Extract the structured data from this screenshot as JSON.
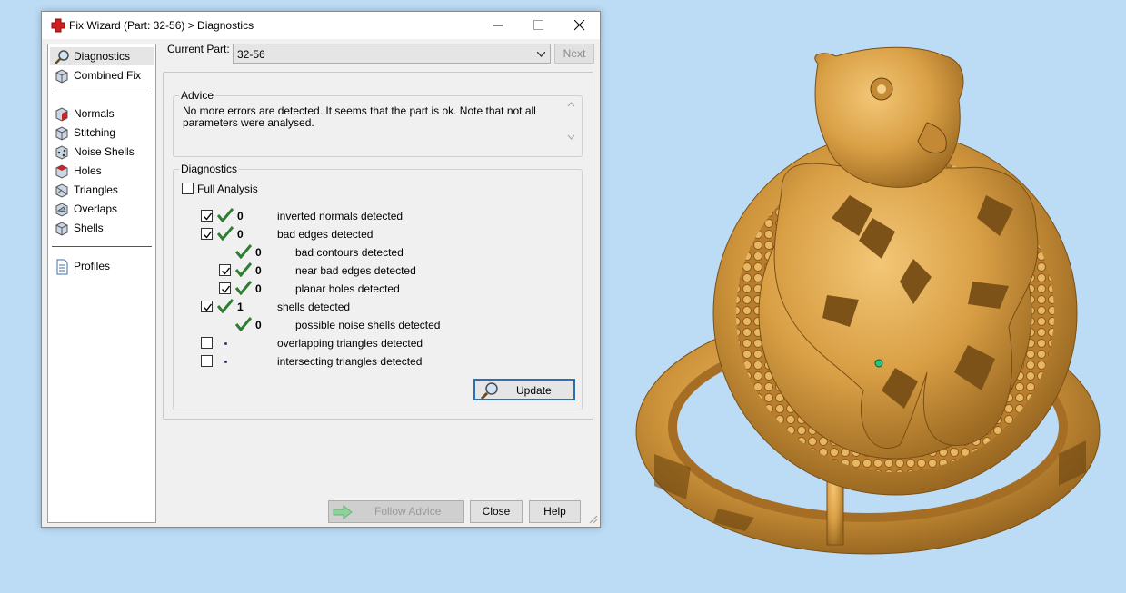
{
  "window": {
    "title": "Fix Wizard (Part: 32-56) > Diagnostics",
    "app_icon": "red-cross-icon"
  },
  "nav": {
    "items": [
      {
        "label": "Diagnostics",
        "icon": "magnifier-icon",
        "selected": true
      },
      {
        "label": "Combined Fix",
        "icon": "cube-icon"
      },
      {
        "label": "Normals",
        "icon": "normals-cube-icon"
      },
      {
        "label": "Stitching",
        "icon": "stitching-cube-icon"
      },
      {
        "label": "Noise Shells",
        "icon": "noise-shells-cube-icon"
      },
      {
        "label": "Holes",
        "icon": "holes-cube-icon"
      },
      {
        "label": "Triangles",
        "icon": "triangles-cube-icon"
      },
      {
        "label": "Overlaps",
        "icon": "overlaps-cube-icon"
      },
      {
        "label": "Shells",
        "icon": "shells-cube-icon"
      },
      {
        "label": "Profiles",
        "icon": "document-icon"
      }
    ]
  },
  "part": {
    "label": "Current Part:",
    "value": "32-56",
    "next_label": "Next"
  },
  "advice": {
    "title": "Advice",
    "text_line1": "No more errors are detected. It seems that the part is ok. Note that not all",
    "text_line2": "parameters were analysed."
  },
  "diagnostics": {
    "title": "Diagnostics",
    "full_analysis_label": "Full Analysis",
    "full_analysis_checked": false,
    "rows": [
      {
        "checked": true,
        "status": "ok",
        "count": "0",
        "label": "inverted normals detected",
        "indent": 0,
        "has_checkbox": true
      },
      {
        "checked": true,
        "status": "ok",
        "count": "0",
        "label": "bad edges detected",
        "indent": 0,
        "has_checkbox": true
      },
      {
        "checked": null,
        "status": "ok",
        "count": "0",
        "label": "bad contours detected",
        "indent": 1,
        "has_checkbox": false
      },
      {
        "checked": true,
        "status": "ok",
        "count": "0",
        "label": "near bad edges detected",
        "indent": 1,
        "has_checkbox": true
      },
      {
        "checked": true,
        "status": "ok",
        "count": "0",
        "label": "planar holes detected",
        "indent": 1,
        "has_checkbox": true
      },
      {
        "checked": true,
        "status": "ok",
        "count": "1",
        "label": "shells detected",
        "indent": 0,
        "has_checkbox": true
      },
      {
        "checked": null,
        "status": "ok",
        "count": "0",
        "label": "possible noise shells detected",
        "indent": 1,
        "has_checkbox": false
      },
      {
        "checked": false,
        "status": "not-run",
        "count": "",
        "label": "overlapping triangles detected",
        "indent": 0,
        "has_checkbox": true
      },
      {
        "checked": false,
        "status": "not-run",
        "count": "",
        "label": "intersecting triangles detected",
        "indent": 0,
        "has_checkbox": true
      }
    ],
    "update_label": "Update"
  },
  "buttons": {
    "follow_advice": "Follow Advice",
    "close": "Close",
    "help": "Help"
  },
  "colors": {
    "viewport_bg": "#bcdcf6",
    "model": "#d9a24c",
    "tick": "#2e7d32",
    "focus": "#2d6fb5"
  }
}
